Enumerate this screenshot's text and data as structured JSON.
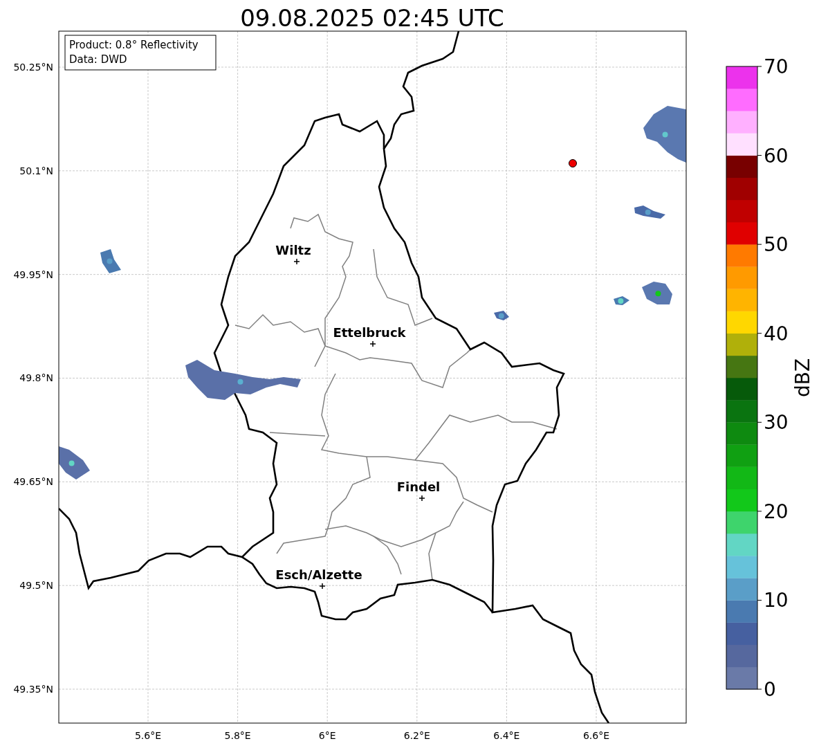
{
  "title": "09.08.2025 02:45 UTC",
  "info_box": {
    "lines": [
      "Product: 0.8° Reflectivity",
      "Data: DWD"
    ]
  },
  "map": {
    "yticks": [
      "50.25°N",
      "50.1°N",
      "49.95°N",
      "49.8°N",
      "49.65°N",
      "49.5°N",
      "49.35°N"
    ],
    "xticks": [
      "5.6°E",
      "5.8°E",
      "6°E",
      "6.2°E",
      "6.4°E",
      "6.6°E"
    ],
    "cities": [
      {
        "name": "Wiltz"
      },
      {
        "name": "Ettelbruck"
      },
      {
        "name": "Findel"
      },
      {
        "name": "Esch/Alzette"
      }
    ]
  },
  "colorbar": {
    "label": "dBZ",
    "ticks": [
      "70",
      "60",
      "50",
      "40",
      "30",
      "20",
      "10",
      "0"
    ],
    "bins": [
      {
        "color": "#6a7aa8"
      },
      {
        "color": "#56689e"
      },
      {
        "color": "#4660a0"
      },
      {
        "color": "#4a7ab0"
      },
      {
        "color": "#5a9ec8"
      },
      {
        "color": "#66c2da"
      },
      {
        "color": "#62d6c4"
      },
      {
        "color": "#3ed46c"
      },
      {
        "color": "#12c81a"
      },
      {
        "color": "#12b816"
      },
      {
        "color": "#10a012"
      },
      {
        "color": "#0e8a10"
      },
      {
        "color": "#0a7410"
      },
      {
        "color": "#065a0a"
      },
      {
        "color": "#467612"
      },
      {
        "color": "#b0b00a"
      },
      {
        "color": "#ffd700"
      },
      {
        "color": "#ffb400"
      },
      {
        "color": "#ff9a00"
      },
      {
        "color": "#ff7a00"
      },
      {
        "color": "#e00000"
      },
      {
        "color": "#c00000"
      },
      {
        "color": "#a00000"
      },
      {
        "color": "#780000"
      },
      {
        "color": "#ffe0ff"
      },
      {
        "color": "#ffb0ff"
      },
      {
        "color": "#ff6cff"
      },
      {
        "color": "#ec32ec"
      }
    ]
  }
}
